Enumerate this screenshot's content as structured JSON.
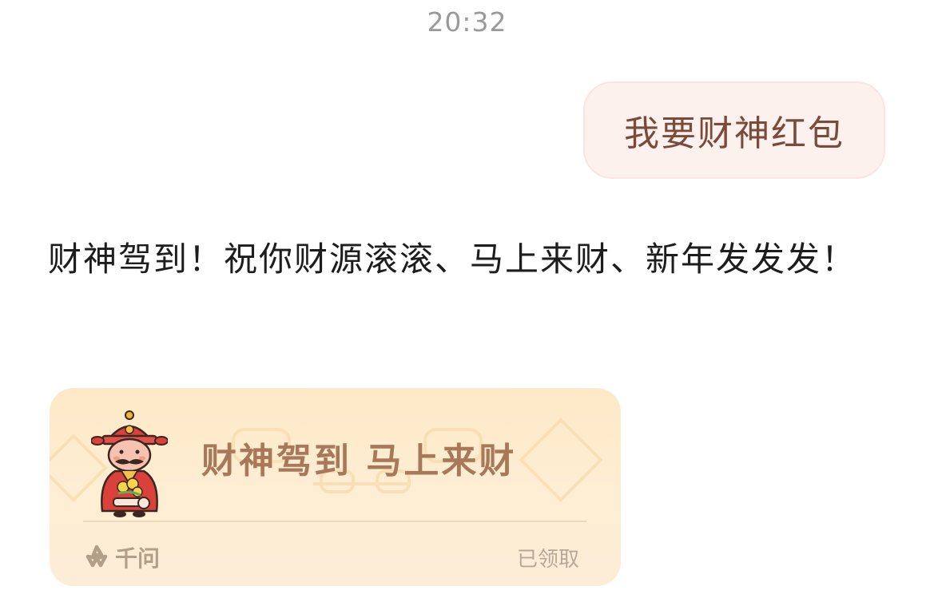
{
  "timestamp": "20:32",
  "user_message": {
    "text": "我要财神红包"
  },
  "bot_message": {
    "text": "财神驾到！祝你财源滚滚、马上来财、新年发发发！"
  },
  "red_packet": {
    "title": "财神驾到 马上来财",
    "brand_name": "千问",
    "brand_icon": "qianwen-logo-icon",
    "mascot_icon": "god-of-wealth-icon",
    "status": "已领取"
  },
  "colors": {
    "user_bubble_bg": "#fdf1ee",
    "user_text": "#7a4b3a",
    "card_bg": "#fde9c6",
    "card_title": "#a8785a",
    "timestamp": "#9a9a9a"
  }
}
